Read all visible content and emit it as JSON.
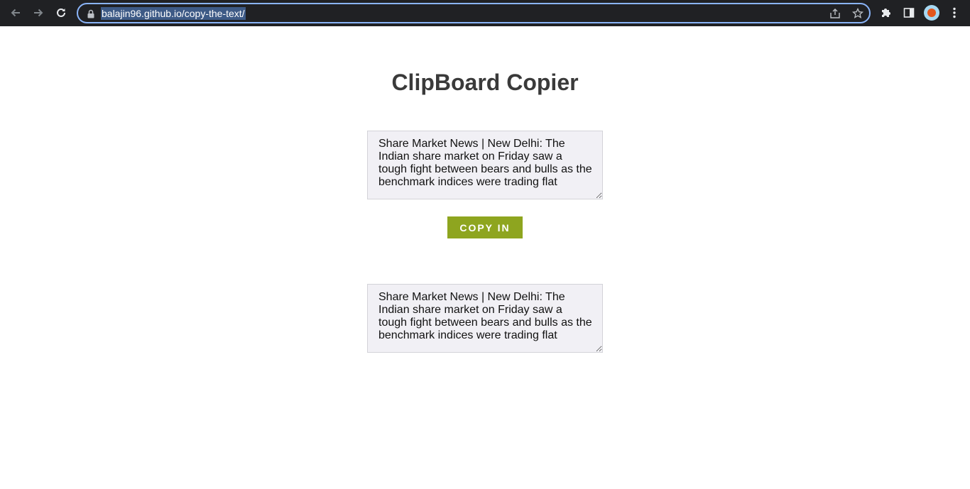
{
  "browser": {
    "url": "balajin96.github.io/copy-the-text/",
    "icons": {
      "back": "back-arrow-icon",
      "forward": "forward-arrow-icon",
      "reload": "reload-icon",
      "lock": "lock-icon",
      "share": "share-icon",
      "bookmark": "star-icon",
      "extensions": "puzzle-icon",
      "side_panel": "side-panel-icon",
      "profile": "avatar",
      "menu": "kebab-menu-icon"
    },
    "colors": {
      "toolbar": "#202124",
      "omnibox_border": "#8ab4f8",
      "url_highlight": "#3d5a86"
    }
  },
  "page": {
    "title": "ClipBoard Copier",
    "source_text": "Share Market News | New Delhi: The Indian share market on Friday saw a tough fight between bears and bulls as the benchmark indices were trading flat",
    "copy_button_label": "COPY IN",
    "target_text": "Share Market News | New Delhi: The Indian share market on Friday saw a tough fight between bears and bulls as the benchmark indices were trading flat",
    "colors": {
      "button": "#8ea51f",
      "textarea_bg": "#f1f0f5",
      "title": "#3a3a3a"
    }
  }
}
